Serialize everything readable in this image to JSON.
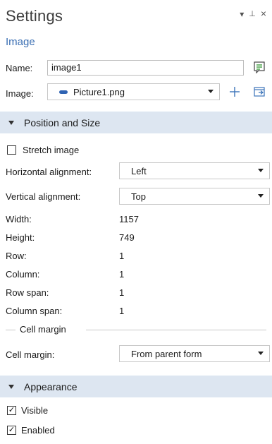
{
  "header": {
    "title": "Settings",
    "subtitle": "Image",
    "controls": [
      "▾",
      "⊥",
      "×"
    ]
  },
  "fields": {
    "name_label": "Name:",
    "name_value": "image1",
    "image_label": "Image:",
    "image_value": "Picture1.png"
  },
  "sections": {
    "position_size": "Position and Size",
    "appearance": "Appearance"
  },
  "position": {
    "stretch_label": "Stretch image",
    "stretch_checked": false,
    "h_align_label": "Horizontal alignment:",
    "h_align_value": "Left",
    "v_align_label": "Vertical alignment:",
    "v_align_value": "Top",
    "rows": [
      {
        "label": "Width:",
        "value": "1157"
      },
      {
        "label": "Height:",
        "value": "749"
      },
      {
        "label": "Row:",
        "value": "1"
      },
      {
        "label": "Column:",
        "value": "1"
      },
      {
        "label": "Row span:",
        "value": "1"
      },
      {
        "label": "Column span:",
        "value": "1"
      }
    ],
    "cell_margin_group": "Cell margin",
    "cell_margin_label": "Cell margin:",
    "cell_margin_value": "From parent form"
  },
  "appearance": {
    "visible_label": "Visible",
    "visible_checked": true,
    "enabled_label": "Enabled",
    "enabled_checked": true
  },
  "icons": {
    "edit": "edit-text-icon",
    "add": "add-icon",
    "import": "import-icon",
    "image_type": "image-chip-icon"
  },
  "colors": {
    "accent": "#3b6fb3",
    "section_bg": "#dde6f1"
  }
}
